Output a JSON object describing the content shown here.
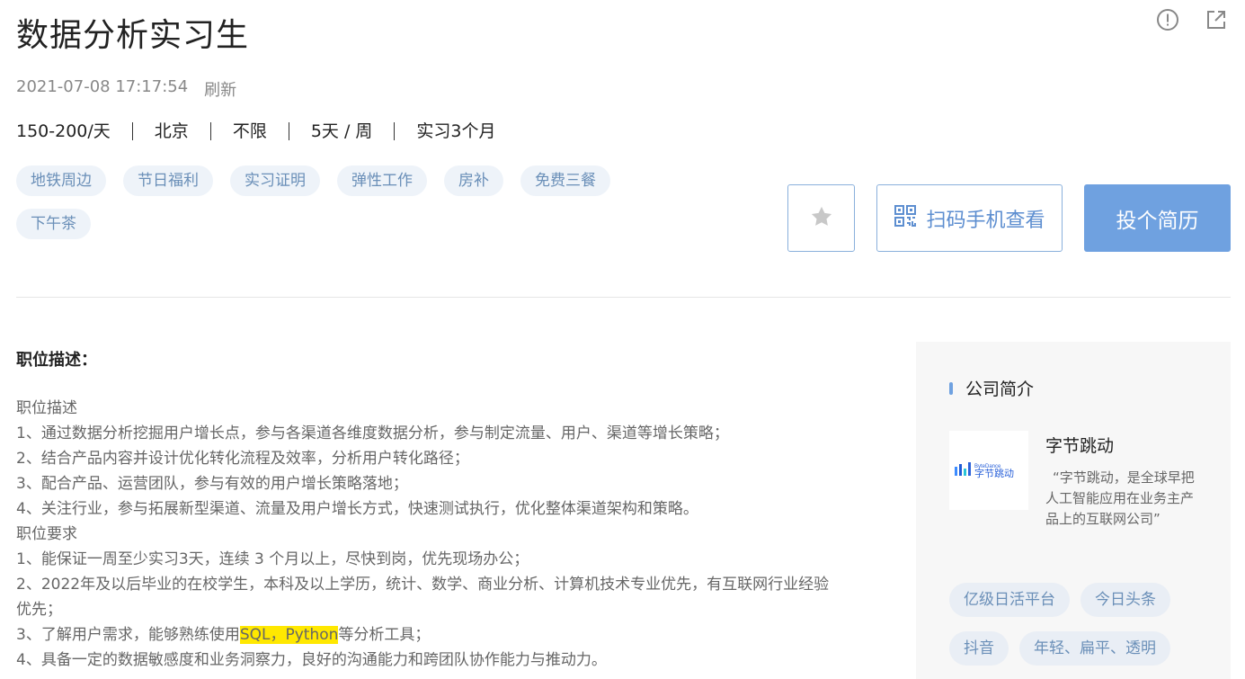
{
  "job": {
    "title": "数据分析实习生",
    "datetime": "2021-07-08 17:17:54",
    "refresh_label": "刷新",
    "specs": [
      "150-200/天",
      "北京",
      "不限",
      "5天 / 周",
      "实习3个月"
    ],
    "tags": [
      "地铁周边",
      "节日福利",
      "实习证明",
      "弹性工作",
      "房补",
      "免费三餐",
      "下午茶"
    ]
  },
  "actions": {
    "qr_label": "扫码手机查看",
    "apply_label": "投个简历"
  },
  "icons": {
    "report": "alert-circle-icon",
    "share": "external-link-icon",
    "favorite": "star-icon",
    "qr": "qr-code-icon"
  },
  "description": {
    "heading": "职位描述：",
    "lines": [
      "职位描述",
      "1、通过数据分析挖掘用户增长点，参与各渠道各维度数据分析，参与制定流量、用户、渠道等增长策略；",
      "2、结合产品内容并设计优化转化流程及效率，分析用户转化路径；",
      "3、配合产品、运营团队，参与有效的用户增长策略落地；",
      "4、关注行业，参与拓展新型渠道、流量及用户增长方式，快速测试执行，优化整体渠道架构和策略。",
      "职位要求",
      "1、能保证一周至少实习3天，连续 3 个月以上，尽快到岗，优先现场办公；",
      "2、2022年及以后毕业的在校学生，本科及以上学历，统计、数学、商业分析、计算机技术专业优先，有互联网行业经验",
      "优先；"
    ],
    "line8_before": "3、了解用户需求，能够熟练使用",
    "line8_highlight": "SQL，Python",
    "line8_after": "等分析工具；",
    "line9": "4、具备一定的数据敏感度和业务洞察力，良好的沟通能力和跨团队协作能力与推动力。"
  },
  "company": {
    "section_title": "公司简介",
    "logo_small": "ByteDance",
    "logo_text": "字节跳动",
    "name": "字节跳动",
    "desc": "“字节跳动，是全球早把人工智能应用在业务主产品上的互联网公司”",
    "tags": [
      "亿级日活平台",
      "今日头条",
      "抖音",
      "年轻、扁平、透明"
    ]
  },
  "colors": {
    "accent": "#6fa1e0",
    "tag_bg": "#eef3f9",
    "tag_text": "#6a8fb8",
    "highlight": "#ffe800"
  }
}
